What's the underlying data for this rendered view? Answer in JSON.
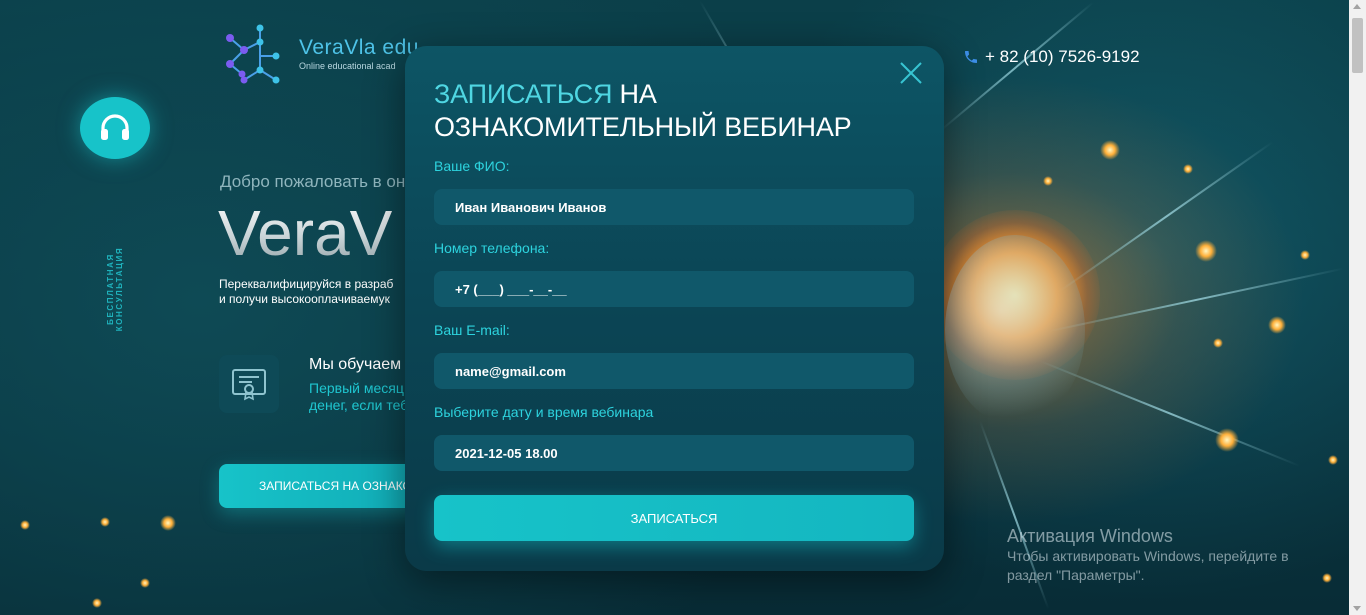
{
  "header": {
    "logo_title": "VeraVla edu",
    "logo_subtitle": "Online educational acad",
    "phone": "+ 82 (10) 7526-9192"
  },
  "side": {
    "consult_icon": "headphones-icon",
    "consult_vertical_text": "БЕСПЛАТНАЯ КОНСУЛЬТАЦИЯ"
  },
  "hero": {
    "welcome": "Добро пожаловать в онл",
    "title": "VeraV",
    "text_line1": "Переквалифицируйся в разраб",
    "text_line2": "и получи высокооплачиваемук",
    "teach_title": "Мы обучаем",
    "teach_line1": "Первый месяц",
    "teach_line2": "денег, если тебе",
    "cta_label": "ЗАПИСАТЬСЯ НА ОЗНАКО"
  },
  "modal": {
    "heading_accent": "ЗАПИСАТЬСЯ",
    "heading_rest_line1": " НА",
    "heading_line2": "ОЗНАКОМИТЕЛЬНЫЙ ВЕБИНАР",
    "name_label": "Ваше ФИО:",
    "name_value": "Иван Иванович Иванов",
    "phone_label": "Номер телефона:",
    "phone_value": "+7 (___) ___-__-__",
    "email_label": "Ваш E-mail:",
    "email_value": "name@gmail.com",
    "date_label": "Выберите дату и время вебинара",
    "date_value": "2021-12-05 18.00",
    "submit_label": "ЗАПИСАТЬСЯ"
  },
  "watermark": {
    "title": "Активация Windows",
    "line1": "Чтобы активировать Windows, перейдите в",
    "line2": "раздел \"Параметры\"."
  },
  "colors": {
    "accent": "#17c3c9",
    "label": "#2dd3de",
    "modal_bg": "#0b4656",
    "field_bg": "#10586a"
  }
}
